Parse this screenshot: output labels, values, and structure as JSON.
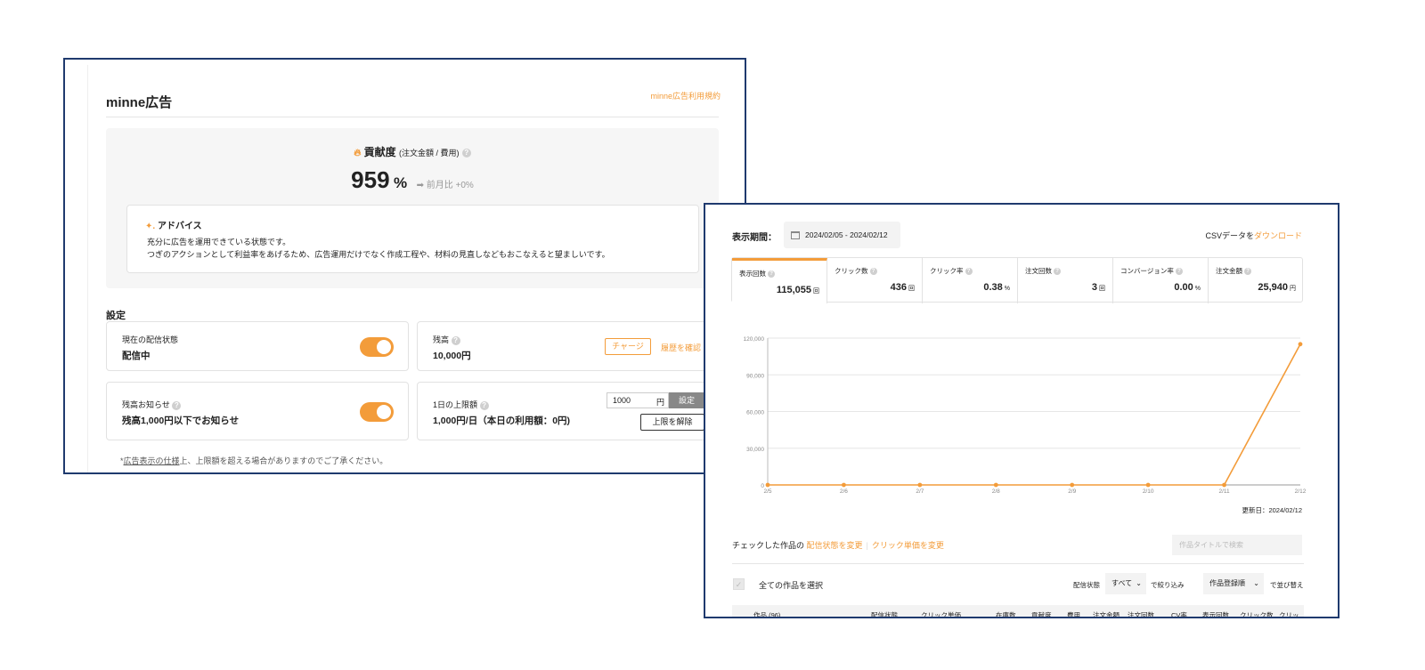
{
  "left": {
    "title": "minne広告",
    "terms_link": "minne広告利用規約",
    "contribution": {
      "icon": "flame-icon",
      "label": "貢献度",
      "sub": "(注文金額 / 費用)",
      "value": "959",
      "unit": "%",
      "delta": "➡ 前月比 +0%"
    },
    "advice": {
      "icon": "sparkle-icon",
      "title": "アドバイス",
      "line1": "充分に広告を運用できている状態です。",
      "line2": "つぎのアクションとして利益率をあげるため、広告運用だけでなく作成工程や、材料の見直しなどもおこなえると望ましいです。"
    },
    "settings_heading": "設定",
    "delivery": {
      "label": "現在の配信状態",
      "value": "配信中",
      "toggle_on": true
    },
    "balance": {
      "label": "残高",
      "value": "10,000円",
      "charge_btn": "チャージ",
      "history_link": "履歴を確認"
    },
    "balance_notice": {
      "label": "残高お知らせ",
      "value": "残高1,000円以下でお知らせ",
      "toggle_on": true
    },
    "daily_limit": {
      "label": "1日の上限額",
      "value": "1,000円/日（本日の利用額：0円)",
      "input_value": "1000",
      "input_unit": "円",
      "set_btn": "設定",
      "remove_btn": "上限を解除"
    },
    "note_prefix": "*",
    "note_link": "広告表示の仕様",
    "note_text": "上、上限額を超える場合がありますのでご了承ください。"
  },
  "right": {
    "period_label": "表示期間：",
    "date_range": "2024/02/05 - 2024/02/12",
    "csv_text": "CSVデータを",
    "csv_link": "ダウンロード",
    "tabs": [
      {
        "label": "表示回数",
        "value": "115,055",
        "unit": "回"
      },
      {
        "label": "クリック数",
        "value": "436",
        "unit": "回"
      },
      {
        "label": "クリック率",
        "value": "0.38",
        "unit": "%"
      },
      {
        "label": "注文回数",
        "value": "3",
        "unit": "回"
      },
      {
        "label": "コンバージョン率",
        "value": "0.00",
        "unit": "%"
      },
      {
        "label": "注文金額",
        "value": "25,940",
        "unit": "円"
      }
    ],
    "updated": "更新日：2024/02/12",
    "bulk_prefix": "チェックした作品の",
    "bulk_status": "配信状態を変更",
    "bulk_cpc": "クリック単価を変更",
    "search_placeholder": "作品タイトルで検索",
    "select_all": "全ての作品を選択",
    "filter_label": "配信状態",
    "filter_value": "すべて",
    "filter_suffix": "で絞り込み",
    "sort_value": "作品登録順",
    "sort_suffix": "で並び替え",
    "table_headers": [
      "作品 (96)",
      "配信状態",
      "クリック単価",
      "在庫数",
      "貢献度",
      "費用",
      "注文金額",
      "注文回数",
      "CV率",
      "表示回数",
      "クリック数",
      "クリッ"
    ]
  },
  "chart_data": {
    "type": "line",
    "x": [
      "2/5",
      "2/6",
      "2/7",
      "2/8",
      "2/9",
      "2/10",
      "2/11",
      "2/12"
    ],
    "series": [
      {
        "values": [
          0,
          0,
          0,
          0,
          0,
          0,
          0,
          115055
        ],
        "color": "#f39c3a"
      }
    ],
    "ylim": [
      0,
      120000
    ],
    "yticks": [
      "0",
      "30,000",
      "60,000",
      "90,000",
      "120,000"
    ],
    "grid": true
  }
}
